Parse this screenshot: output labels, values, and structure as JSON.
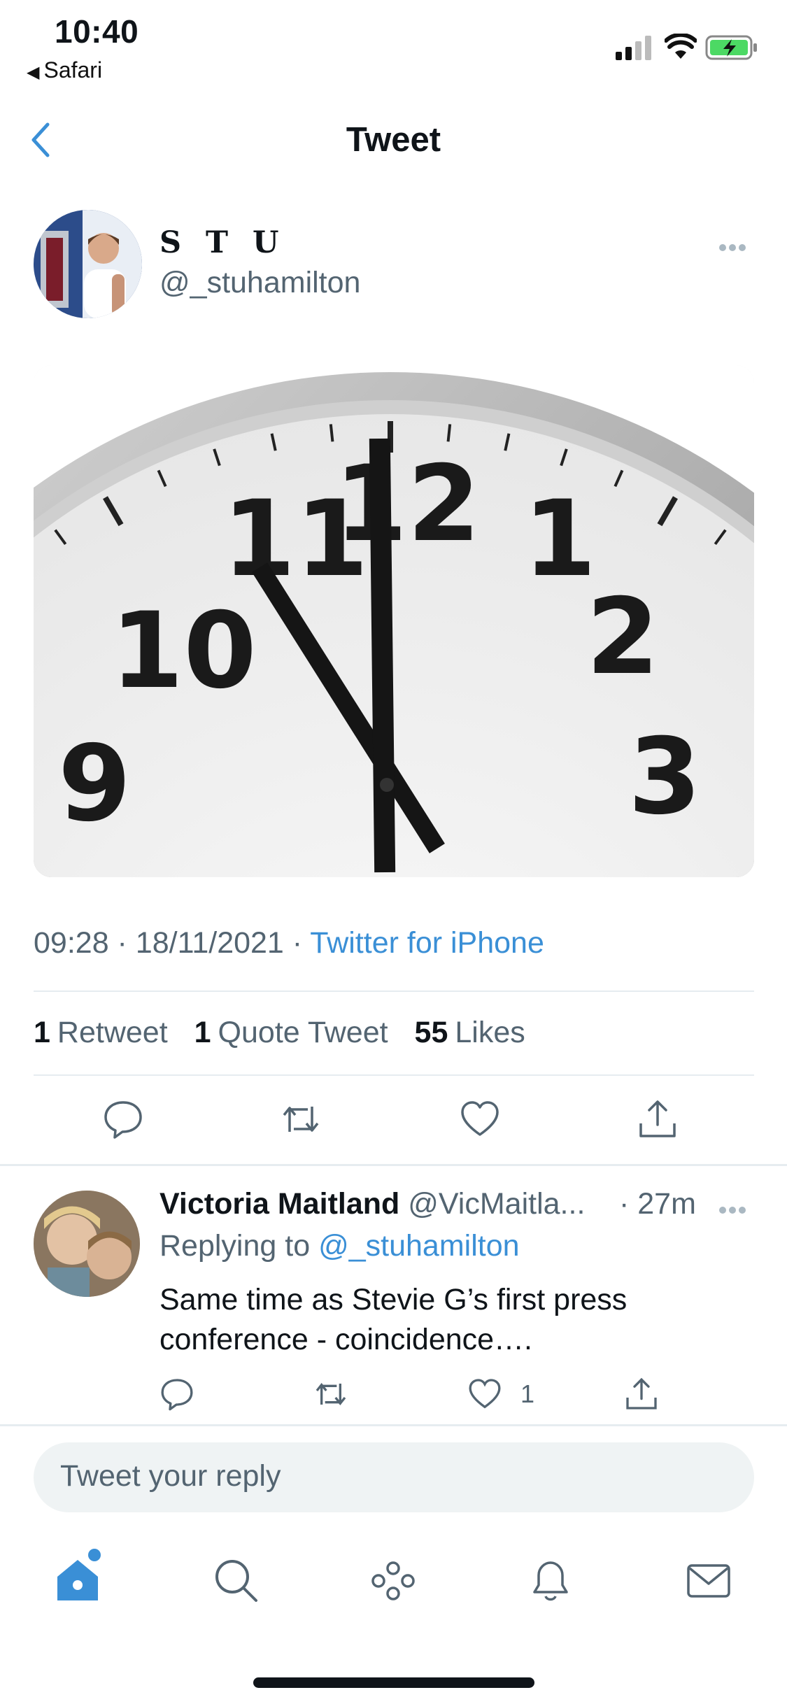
{
  "status_bar": {
    "time": "10:40",
    "back_app": "Safari"
  },
  "nav": {
    "title": "Tweet"
  },
  "tweet": {
    "author_name": "S T U",
    "author_handle": "@_stuhamilton",
    "time": "09:28",
    "date": "18/11/2021",
    "source": "Twitter for iPhone",
    "media_icon": "clock-photo"
  },
  "stats": {
    "retweets_count": "1",
    "retweets_label": "Retweet",
    "quotes_count": "1",
    "quotes_label": "Quote Tweet",
    "likes_count": "55",
    "likes_label": "Likes"
  },
  "reply": {
    "name": "Victoria Maitland",
    "handle": "@VicMaitla...",
    "time": "· 27m",
    "replying_prefix": "Replying to",
    "replying_handle": "@_stuhamilton",
    "text": "Same time as Stevie G’s first press conference - coincidence….",
    "like_count": "1"
  },
  "compose": {
    "placeholder": "Tweet your reply"
  },
  "colors": {
    "accent": "#3a8fd6",
    "text": "#0f1419",
    "secondary": "#536471"
  },
  "tab_bar": [
    "home-icon",
    "search-icon",
    "spaces-icon",
    "notifications-icon",
    "messages-icon"
  ]
}
